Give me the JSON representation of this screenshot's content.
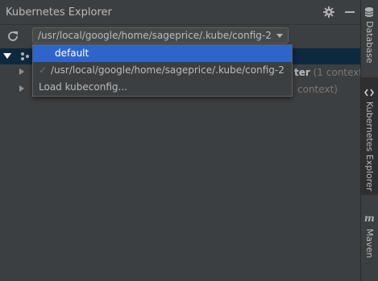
{
  "window": {
    "title": "Kubernetes Explorer",
    "gear_icon": "gear-icon",
    "minimize_icon": "minimize-icon"
  },
  "toolbar": {
    "refresh_icon": "refresh-icon",
    "kubeconfig_selected": "/usr/local/google/home/sageprice/.kube/config-2"
  },
  "tree": {
    "rows": [
      {
        "bold_tail": "ter",
        "muted_tail": "(1 context"
      },
      {
        "muted_tail": "context)"
      }
    ]
  },
  "dropdown": {
    "options": [
      {
        "label": "default",
        "highlighted": true
      },
      {
        "label": "/usr/local/google/home/sageprice/.kube/config-2",
        "checked": true,
        "check_glyph": "✓"
      },
      {
        "label": "Load kubeconfig..."
      }
    ]
  },
  "side_tabs": [
    {
      "label": "Database",
      "icon": "database-icon"
    },
    {
      "label": "Kubernetes Explorer",
      "icon": "kubernetes-icon",
      "active": true
    },
    {
      "label": "Maven",
      "icon": "maven-icon",
      "glyph": "m"
    }
  ],
  "colors": {
    "background": "#3c3f41",
    "selection": "#0d293e",
    "highlight": "#2f65ca"
  }
}
